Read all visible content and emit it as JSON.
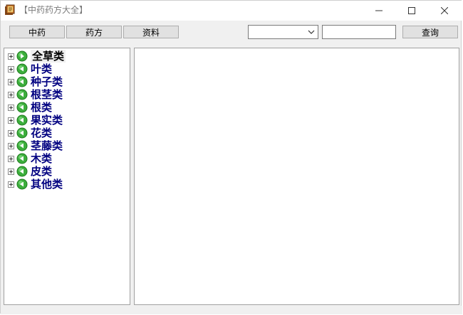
{
  "window": {
    "title": "【中药药方大全】"
  },
  "title_buttons": {
    "minimize_symbol": "—",
    "maximize_symbol": "☐",
    "close_symbol": "✕"
  },
  "toolbar": {
    "btn1": "中药",
    "btn2": "药方",
    "btn3": "资料",
    "combo_value": "",
    "search_value": "",
    "search_button": "查询"
  },
  "tree": {
    "items": [
      {
        "label": "全草类"
      },
      {
        "label": "叶类"
      },
      {
        "label": "种子类"
      },
      {
        "label": "根茎类"
      },
      {
        "label": "根类"
      },
      {
        "label": "果实类"
      },
      {
        "label": "花类"
      },
      {
        "label": "茎藤类"
      },
      {
        "label": "木类"
      },
      {
        "label": "皮类"
      },
      {
        "label": "其他类"
      }
    ]
  },
  "icons": {
    "app": "book-icon",
    "node": "green-arrow-circle-icon"
  },
  "colors": {
    "node_label": "#000080",
    "node_icon": "#3cae3c"
  }
}
